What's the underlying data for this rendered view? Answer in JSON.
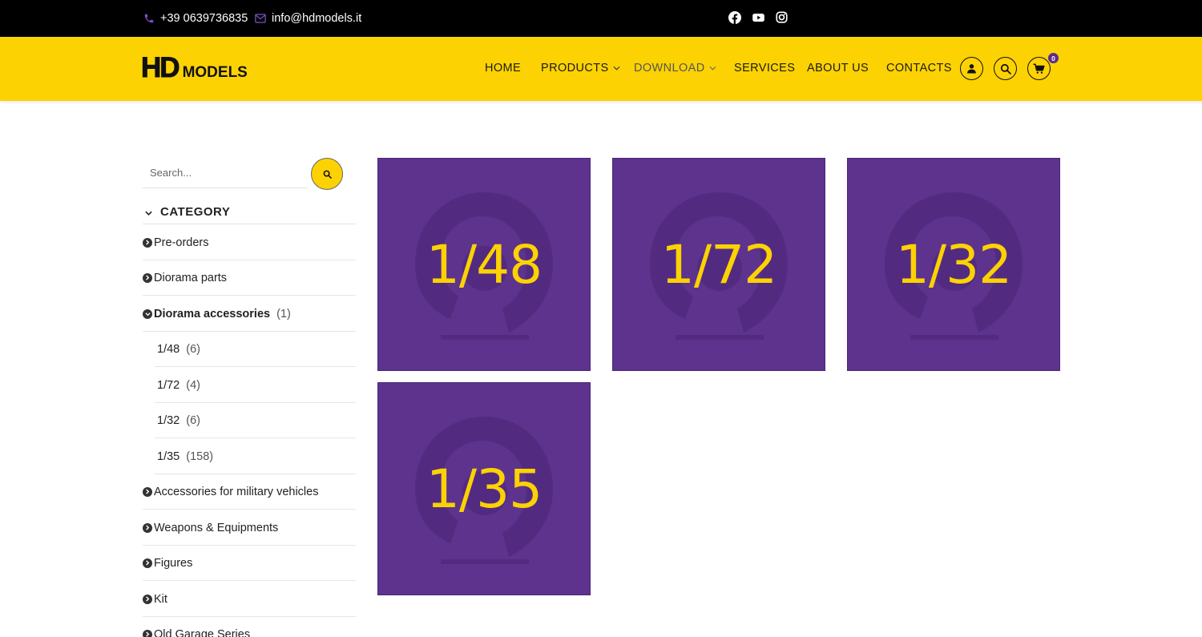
{
  "topbar": {
    "phone": "+39 0639736835",
    "email": "info@hdmodels.it",
    "socials": [
      "facebook-icon",
      "youtube-icon",
      "instagram-icon"
    ]
  },
  "header": {
    "logo_mark": "HD",
    "logo_text": "MODELS",
    "nav": [
      "HOME",
      "PRODUCTS",
      "DOWNLOAD",
      "SERVICES",
      "ABOUT US",
      "CONTACTS"
    ],
    "cart_count": "0"
  },
  "sidebar": {
    "search_placeholder": "Search...",
    "category_title": "CATEGORY",
    "categories": [
      {
        "label": "Pre-orders",
        "count": ""
      },
      {
        "label": "Diorama parts",
        "count": ""
      },
      {
        "label": "Diorama accessories",
        "count": "(1)"
      },
      {
        "label": "1/48",
        "count": "(6)"
      },
      {
        "label": "1/72",
        "count": "(4)"
      },
      {
        "label": "1/32",
        "count": "(6)"
      },
      {
        "label": "1/35",
        "count": "(158)"
      },
      {
        "label": "Accessories for military vehicles",
        "count": ""
      },
      {
        "label": "Weapons & Equipments",
        "count": ""
      },
      {
        "label": "Figures",
        "count": ""
      },
      {
        "label": "Kit",
        "count": ""
      },
      {
        "label": "Old Garage Series",
        "count": ""
      }
    ]
  },
  "tiles": [
    "1/48",
    "1/72",
    "1/32",
    "1/35"
  ],
  "colors": {
    "accent_yellow": "#fcd202",
    "tile_purple": "#5d338d",
    "badge_purple": "#5b2b8c",
    "topbar_black": "#000000"
  }
}
